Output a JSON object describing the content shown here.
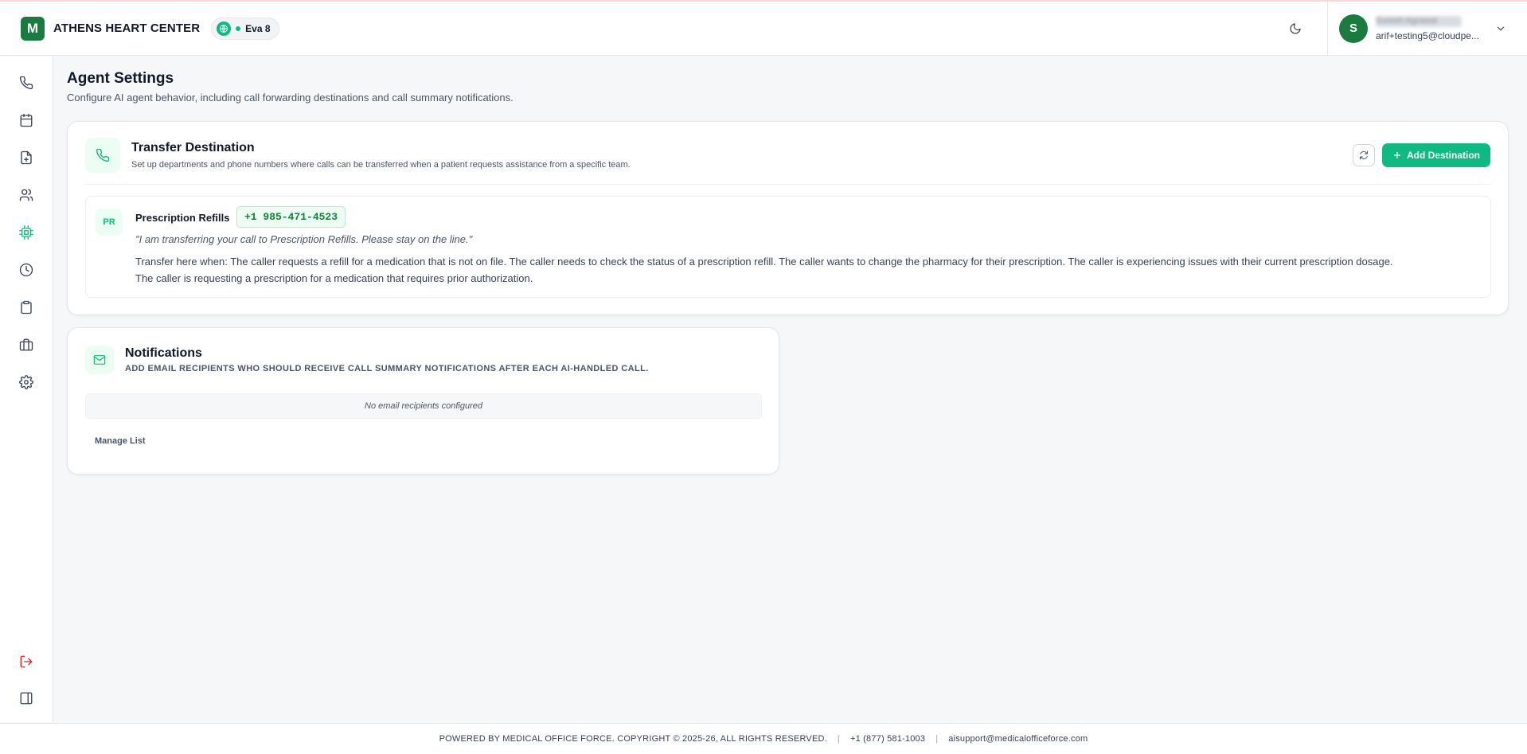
{
  "header": {
    "logo_letter": "M",
    "org_name": "ATHENS HEART CENTER",
    "agent_badge": "Eva 8",
    "user_initial": "S",
    "user_name": "Suresh Agrawal",
    "user_email": "arif+testing5@cloudpe..."
  },
  "sidebar": {
    "items": [
      {
        "icon": "phone-icon",
        "active": false
      },
      {
        "icon": "calendar-icon",
        "active": false
      },
      {
        "icon": "file-plus-icon",
        "active": false
      },
      {
        "icon": "users-icon",
        "active": false
      },
      {
        "icon": "cpu-icon",
        "active": true
      },
      {
        "icon": "clock-icon",
        "active": false
      },
      {
        "icon": "clipboard-icon",
        "active": false
      },
      {
        "icon": "briefcase-icon",
        "active": false
      },
      {
        "icon": "gear-icon",
        "active": false
      }
    ],
    "bottom": [
      {
        "icon": "logout-icon"
      },
      {
        "icon": "sidebar-toggle-icon"
      }
    ]
  },
  "page": {
    "title": "Agent Settings",
    "subtitle": "Configure AI agent behavior, including call forwarding destinations and call summary notifications."
  },
  "transfer": {
    "title": "Transfer Destination",
    "subtitle": "Set up departments and phone numbers where calls can be transferred when a patient requests assistance from a specific team.",
    "add_label": "Add Destination",
    "destinations": [
      {
        "initials": "PR",
        "name": "Prescription Refills",
        "phone": "+1 985-471-4523",
        "quote": "\"I am transferring your call to Prescription Refills. Please stay on the line.\"",
        "description": "Transfer here when: The caller requests a refill for a medication that is not on file. The caller needs to check the status of a prescription refill. The caller wants to change the pharmacy for their prescription. The caller is experiencing issues with their current prescription dosage. The caller is requesting a prescription for a medication that requires prior authorization."
      }
    ]
  },
  "notifications": {
    "title": "Notifications",
    "subtitle": "ADD EMAIL RECIPIENTS WHO SHOULD RECEIVE CALL SUMMARY NOTIFICATIONS AFTER EACH AI-HANDLED CALL.",
    "empty_text": "No email recipients configured",
    "manage_label": "Manage List"
  },
  "footer": {
    "copyright": "POWERED BY MEDICAL OFFICE FORCE. COPYRIGHT © 2025-26, ALL RIGHTS RESERVED.",
    "phone": "+1 (877) 581-1003",
    "email": "aisupport@medicalofficeforce.com"
  },
  "colors": {
    "brand": "#1b7a3f",
    "accent": "#10b981",
    "logout": "#dc2626"
  }
}
